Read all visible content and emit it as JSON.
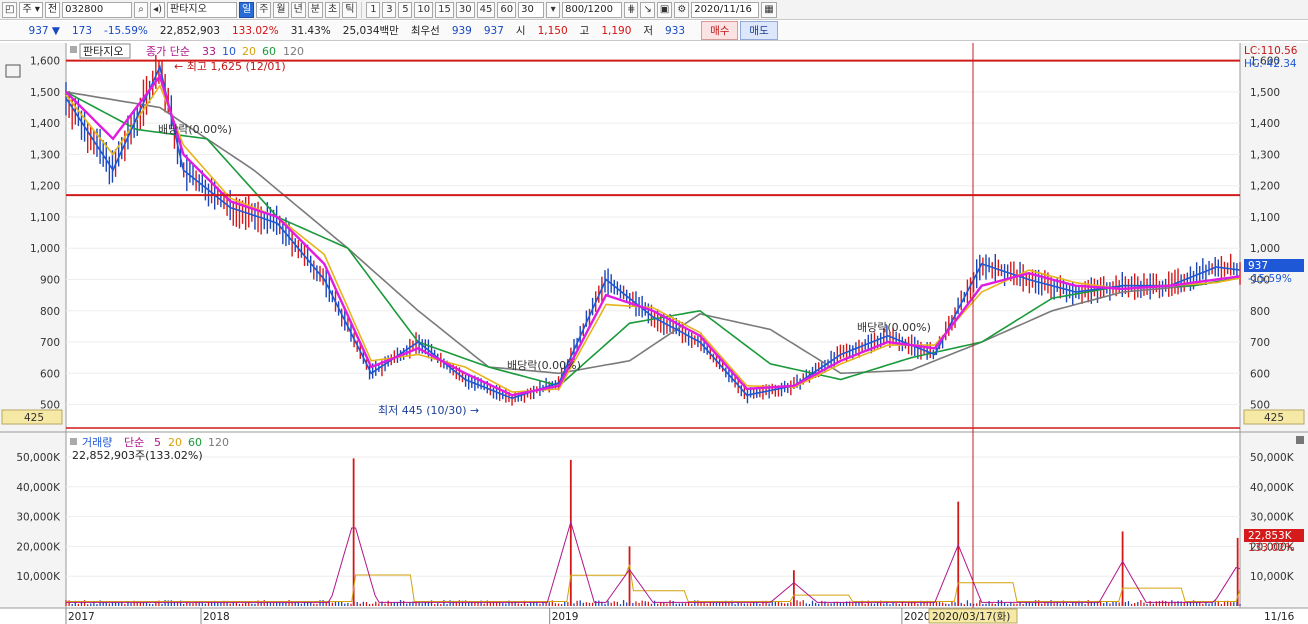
{
  "toolbar": {
    "market": "주",
    "period_type": "전",
    "code": "032800",
    "stock_name": "판타지오",
    "periods": [
      "일",
      "주",
      "월",
      "년",
      "분",
      "초",
      "틱"
    ],
    "active_period": "일",
    "intervals": [
      "1",
      "3",
      "5",
      "10",
      "15",
      "30",
      "45",
      "60"
    ],
    "count_value": "30",
    "data_count": "800",
    "data_total": "/1200",
    "date": "2020/11/16"
  },
  "quote": {
    "price": "937",
    "change": "173",
    "change_pct": "-15.59%",
    "volume": "22,852,903",
    "volume_ratio": "133.02%",
    "turnover": "31.43%",
    "amount": "25,034백만",
    "best_label": "최우선",
    "ask": "939",
    "bid": "937",
    "open_label": "시",
    "open": "1,150",
    "high_label": "고",
    "high": "1,190",
    "low_label": "저",
    "low": "933",
    "buy_label": "매수",
    "sell_label": "매도"
  },
  "chart_legend": {
    "price_tag": "판타지오",
    "price_ma_title": "종가 단순",
    "price_ma_periods": [
      "33",
      "10",
      "20",
      "60",
      "120"
    ],
    "vol_title": "거래량",
    "vol_ma_title": "단순",
    "vol_ma_periods": [
      "5",
      "20",
      "60",
      "120"
    ],
    "vol_value": "22,852,903주(133.02%)"
  },
  "annotations": {
    "high": "최고 1,625 (12/01)",
    "low": "최저 445 (10/30)",
    "dividend1": "배당락(0.00%)",
    "dividend2": "배당락(0.00%)",
    "dividend3": "배당락(0.00%)",
    "lc": "LC:110.56",
    "hc": "HC:-42.34",
    "cur_price": "937",
    "cur_pct": "-15.59%",
    "bottom_label": "425",
    "vol_cur": "22,853K",
    "vol_cur_pct": "133.02%",
    "x_labels": [
      "2017",
      "2018",
      "2019",
      "2020"
    ],
    "crosshair_date": "2020/03/17(화)",
    "last_date": "11/16"
  },
  "chart_data": [
    {
      "type": "line",
      "title": "판타지오",
      "y_ticks": [
        500,
        600,
        700,
        800,
        900,
        1000,
        1100,
        1200,
        1300,
        1400,
        1500,
        1600
      ],
      "y_tick_labels": [
        "500",
        "600",
        "700",
        "800",
        "900",
        "1,000",
        "1,100",
        "1,200",
        "1,300",
        "1,400",
        "1,500",
        "1,600"
      ],
      "ylim": [
        425,
        1650
      ],
      "x_labels": [
        "2017",
        "2018",
        "2019",
        "2020"
      ],
      "hlines": [
        1600,
        1170,
        425
      ],
      "series": [
        {
          "name": "33",
          "color": "#e11be0",
          "x": [
            0,
            0.04,
            0.08,
            0.1,
            0.14,
            0.18,
            0.22,
            0.26,
            0.3,
            0.34,
            0.38,
            0.42,
            0.46,
            0.5,
            0.54,
            0.58,
            0.62,
            0.66,
            0.7,
            0.74,
            0.78,
            0.82,
            0.86,
            0.9,
            0.94,
            0.98,
            1
          ],
          "values": [
            1500,
            1350,
            1550,
            1300,
            1150,
            1100,
            950,
            620,
            680,
            600,
            530,
            560,
            850,
            800,
            720,
            550,
            560,
            640,
            700,
            680,
            880,
            920,
            880,
            870,
            880,
            900,
            910
          ]
        },
        {
          "name": "10",
          "color": "#1f58d6",
          "x": [
            0,
            0.04,
            0.08,
            0.1,
            0.14,
            0.18,
            0.22,
            0.26,
            0.3,
            0.34,
            0.38,
            0.42,
            0.46,
            0.5,
            0.54,
            0.58,
            0.62,
            0.66,
            0.7,
            0.74,
            0.78,
            0.82,
            0.86,
            0.9,
            0.94,
            0.98,
            1
          ],
          "values": [
            1480,
            1250,
            1580,
            1250,
            1130,
            1080,
            900,
            600,
            700,
            580,
            520,
            570,
            900,
            780,
            700,
            530,
            560,
            660,
            720,
            660,
            950,
            900,
            860,
            880,
            880,
            940,
            930
          ]
        },
        {
          "name": "20",
          "color": "#e5b41a",
          "x": [
            0,
            0.04,
            0.08,
            0.1,
            0.14,
            0.18,
            0.22,
            0.26,
            0.3,
            0.34,
            0.38,
            0.42,
            0.46,
            0.5,
            0.54,
            0.58,
            0.62,
            0.66,
            0.7,
            0.74,
            0.78,
            0.82,
            0.86,
            0.9,
            0.94,
            0.98,
            1
          ],
          "values": [
            1490,
            1300,
            1520,
            1330,
            1160,
            1100,
            980,
            640,
            660,
            620,
            540,
            550,
            820,
            810,
            730,
            560,
            555,
            630,
            690,
            690,
            860,
            930,
            890,
            870,
            880,
            890,
            905
          ]
        },
        {
          "name": "60",
          "color": "#1a9a3a",
          "x": [
            0,
            0.06,
            0.12,
            0.18,
            0.24,
            0.3,
            0.36,
            0.42,
            0.48,
            0.54,
            0.6,
            0.66,
            0.72,
            0.78,
            0.84,
            0.9,
            0.96,
            1
          ],
          "values": [
            1500,
            1380,
            1350,
            1100,
            1000,
            700,
            620,
            560,
            760,
            800,
            630,
            580,
            650,
            700,
            840,
            880,
            880,
            905
          ]
        },
        {
          "name": "120",
          "color": "#7a7a7a",
          "x": [
            0,
            0.08,
            0.16,
            0.24,
            0.3,
            0.36,
            0.42,
            0.48,
            0.54,
            0.6,
            0.66,
            0.72,
            0.78,
            0.84,
            0.9,
            0.96,
            1
          ],
          "values": [
            1500,
            1450,
            1250,
            1000,
            800,
            620,
            600,
            640,
            790,
            740,
            600,
            610,
            700,
            800,
            860,
            880,
            905
          ]
        }
      ]
    },
    {
      "type": "bar",
      "title": "거래량",
      "y_ticks": [
        10000,
        20000,
        30000,
        40000,
        50000
      ],
      "y_tick_labels": [
        "10,000K",
        "20,000K",
        "30,000K",
        "40,000K",
        "50,000K"
      ],
      "ylim": [
        0,
        53000
      ],
      "spikes": [
        {
          "x": 0.245,
          "value": 49500
        },
        {
          "x": 0.43,
          "value": 49000
        },
        {
          "x": 0.48,
          "value": 20000
        },
        {
          "x": 0.62,
          "value": 12000
        },
        {
          "x": 0.76,
          "value": 35000
        },
        {
          "x": 0.9,
          "value": 25000
        },
        {
          "x": 0.998,
          "value": 22853
        }
      ]
    }
  ]
}
